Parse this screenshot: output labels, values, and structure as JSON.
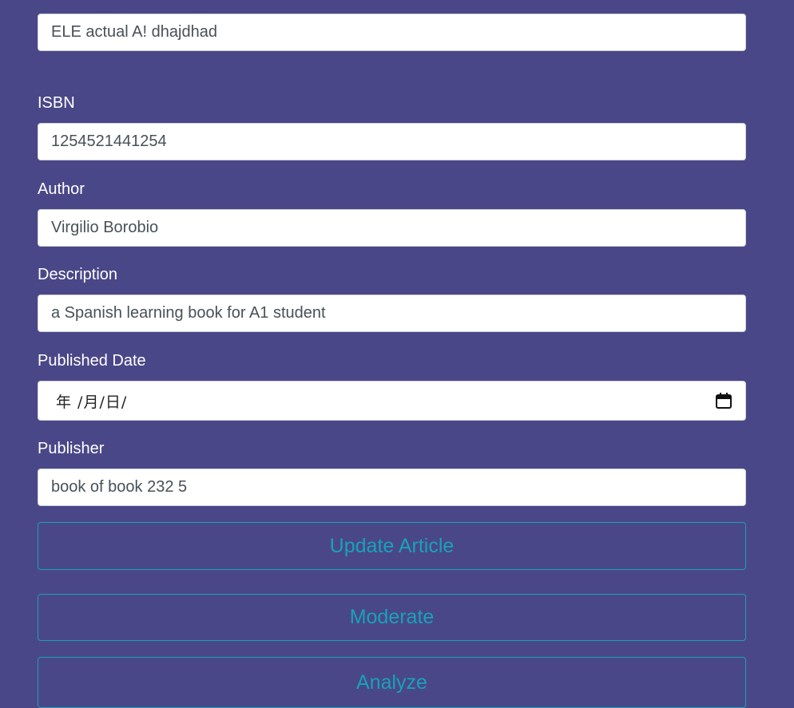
{
  "form": {
    "title_value": "ELE actual A! dhajdhad",
    "isbn": {
      "label": "ISBN",
      "value": "1254521441254"
    },
    "author": {
      "label": "Author",
      "value": "Virgilio Borobio"
    },
    "description": {
      "label": "Description",
      "value": "a Spanish learning book for A1 student"
    },
    "published_date": {
      "label": "Published Date",
      "value": "年 /月/日/",
      "icon": "calendar-icon"
    },
    "publisher": {
      "label": "Publisher",
      "value": "book of book 232 5"
    }
  },
  "actions": {
    "update_label": "Update Article",
    "moderate_label": "Moderate",
    "analyze_label": "Analyze"
  },
  "colors": {
    "background": "#4a4788",
    "accent": "#17a2b8",
    "input_text": "#495057",
    "label_text": "#ffffff"
  }
}
